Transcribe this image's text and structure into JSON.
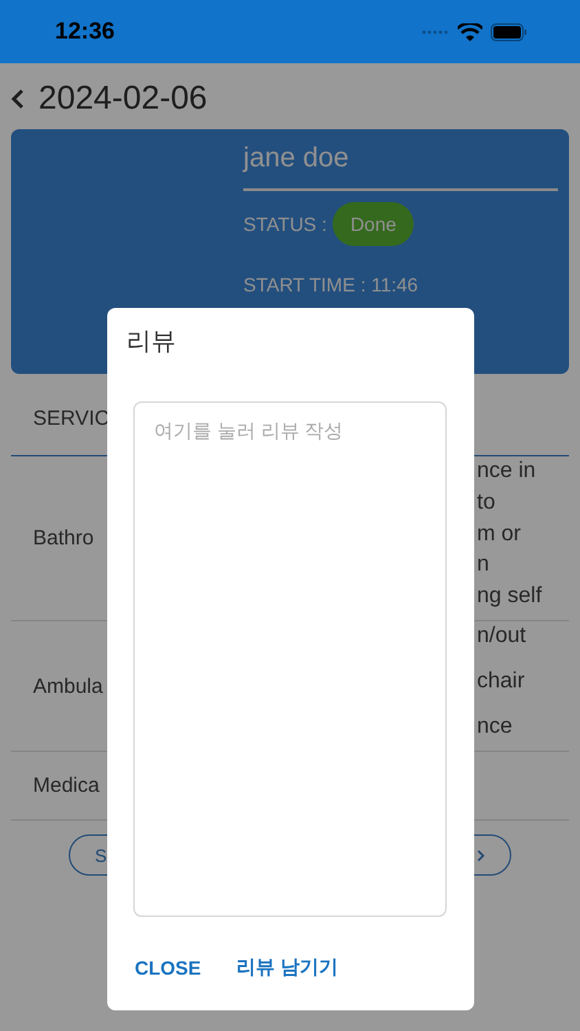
{
  "status_bar": {
    "time": "12:36"
  },
  "header": {
    "title": "2024-02-06"
  },
  "card": {
    "name": "jane doe",
    "status_label": "STATUS :",
    "status": "Done",
    "start_time": "START TIME : 11:46"
  },
  "tab": {
    "label": "SERVIC"
  },
  "rows": [
    {
      "label": "Bathro",
      "detail": [
        "nce in",
        "to",
        "m or",
        "n",
        "ng self"
      ]
    },
    {
      "label": "Ambula",
      "detail": [
        "n/out",
        "chair",
        "nce"
      ]
    },
    {
      "label": "Medica"
    }
  ],
  "actions": {
    "left": "S"
  },
  "dialog": {
    "title": "리뷰",
    "placeholder": "여기를 눌러 리뷰 작성",
    "buttons": [
      "CLOSE",
      "리뷰 남기기"
    ]
  }
}
